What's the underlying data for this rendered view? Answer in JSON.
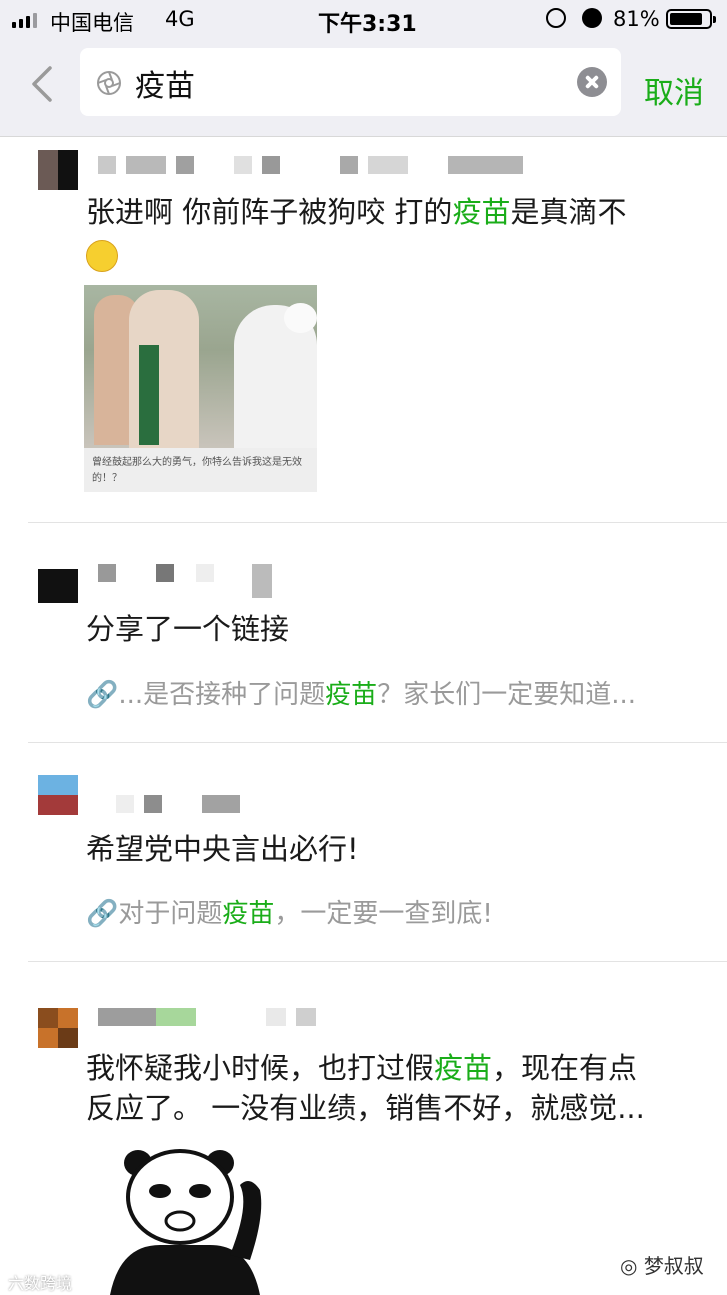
{
  "status_bar": {
    "carrier": "中国电信",
    "network": "4G",
    "time": "下午3:31",
    "battery_percent": "81%",
    "battery_level": 0.81
  },
  "search": {
    "query": "疫苗",
    "cancel_label": "取消",
    "icons": {
      "back": "chevron-left-icon",
      "search": "aperture-search-icon",
      "clear": "clear-icon"
    }
  },
  "posts": [
    {
      "text_before": "张进啊 你前阵子被狗咬 打的",
      "highlight": "疫苗",
      "text_after": "是真滴不",
      "image_caption": "曾经鼓起那么大的勇气，你特么告诉我这是无效的！？"
    },
    {
      "text": "分享了一个链接",
      "link_before": "...是否接种了问题",
      "link_highlight": "疫苗",
      "link_after": "？家长们一定要知道..."
    },
    {
      "text": "希望党中央言出必行!",
      "link_before": "对于问题",
      "link_highlight": "疫苗",
      "link_after": "，一定要一查到底!"
    },
    {
      "line1_before": "我怀疑我小时候，也打过假",
      "highlight": "疫苗",
      "line1_after": "，现在有点",
      "line2": "反应了。 一没有业绩，销售不好，就感觉..."
    }
  ],
  "watermarks": {
    "left": "六数跨境",
    "right": "梦叔叔"
  },
  "colors": {
    "accent_green": "#1aad19",
    "background": "#ffffff",
    "bar_gray": "#efeff4"
  }
}
